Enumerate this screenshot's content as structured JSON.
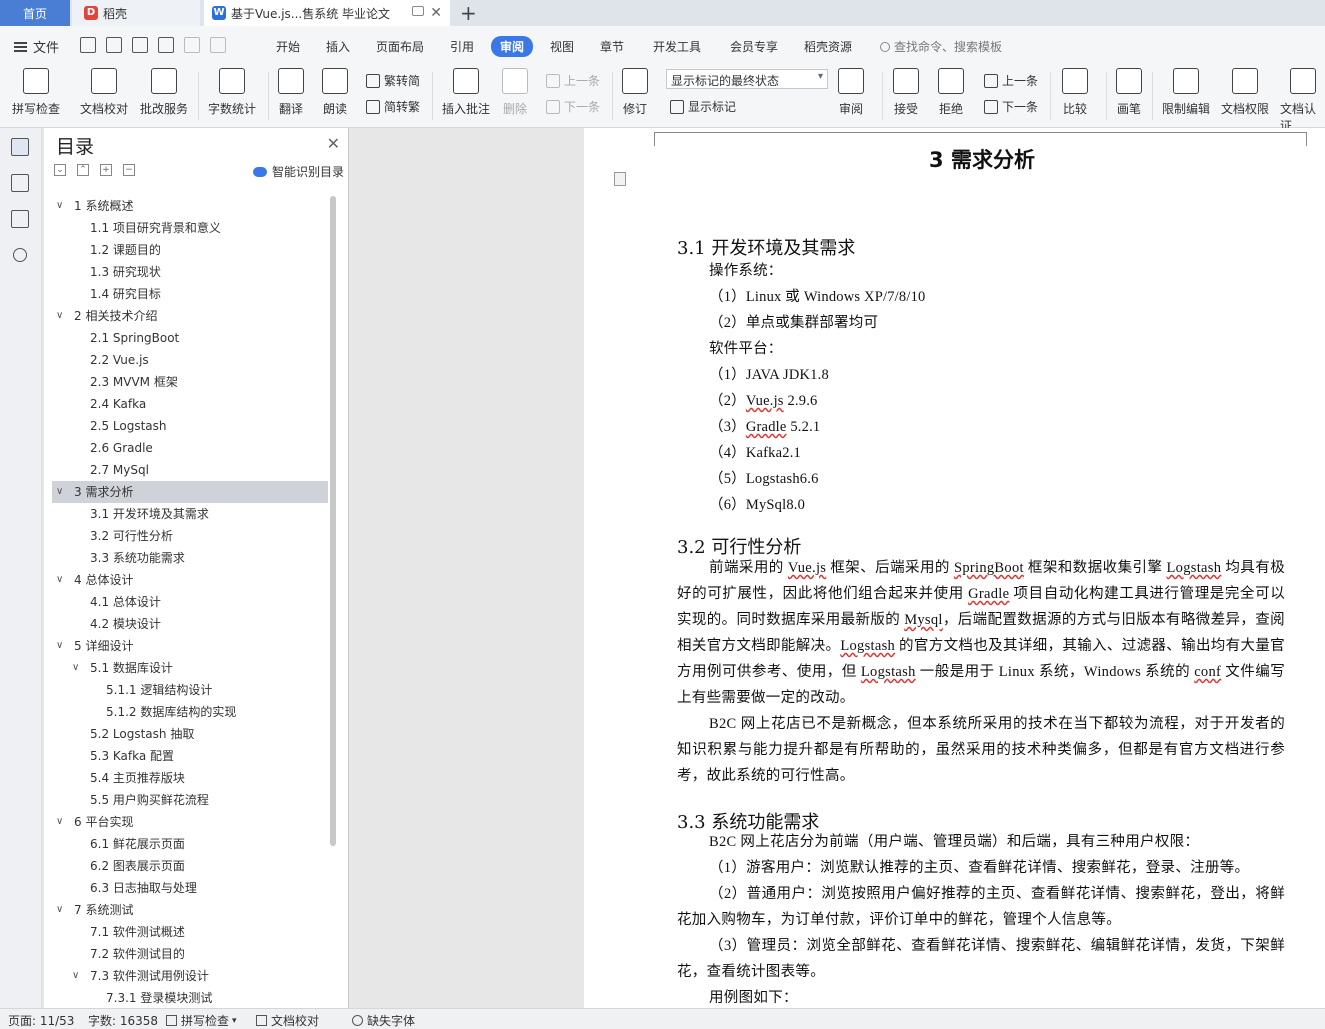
{
  "tabs": {
    "home": "首页",
    "daoke": "稻壳",
    "doc": "基于Vue.js...售系统 毕业论文"
  },
  "menu": {
    "file": "文件",
    "items": [
      "开始",
      "插入",
      "页面布局",
      "引用",
      "审阅",
      "视图",
      "章节",
      "开发工具",
      "会员专享",
      "稻壳资源"
    ],
    "active": "审阅",
    "search_placeholder": "查找命令、搜索模板"
  },
  "ribbon": {
    "spell": "拼写检查",
    "proof": "文档校对",
    "batch": "批改服务",
    "wordcount": "字数统计",
    "translate": "翻译",
    "read": "朗读",
    "trad": "繁转简",
    "simp": "简转繁",
    "insert_comment": "插入批注",
    "delete": "删除",
    "prev_comment": "上一条",
    "next_comment": "下一条",
    "revise": "修订",
    "display_state": "显示标记的最终状态",
    "show_marks": "显示标记",
    "review": "审阅",
    "accept": "接受",
    "reject": "拒绝",
    "prev": "上一条",
    "next": "下一条",
    "compare": "比较",
    "pen": "画笔",
    "restrict": "限制编辑",
    "perm": "文档权限",
    "cert": "文档认证"
  },
  "toc": {
    "title": "目录",
    "smart": "智能识别目录",
    "items": [
      {
        "text": "1  系统概述",
        "level": 1,
        "arrow": "down"
      },
      {
        "text": "1.1  项目研究背景和意义",
        "level": 2
      },
      {
        "text": "1.2  课题目的",
        "level": 2
      },
      {
        "text": "1.3  研究现状",
        "level": 2
      },
      {
        "text": "1.4  研究目标",
        "level": 2
      },
      {
        "text": "2  相关技术介绍",
        "level": 1,
        "arrow": "down"
      },
      {
        "text": "2.1 SpringBoot",
        "level": 2
      },
      {
        "text": "2.2 Vue.js",
        "level": 2
      },
      {
        "text": "2.3 MVVM 框架",
        "level": 2
      },
      {
        "text": "2.4 Kafka",
        "level": 2
      },
      {
        "text": "2.5 Logstash",
        "level": 2
      },
      {
        "text": "2.6 Gradle",
        "level": 2
      },
      {
        "text": "2.7 MySql",
        "level": 2
      },
      {
        "text": "3  需求分析",
        "level": 1,
        "arrow": "down",
        "selected": true
      },
      {
        "text": "3.1  开发环境及其需求",
        "level": 2
      },
      {
        "text": "3.2  可行性分析",
        "level": 2
      },
      {
        "text": "3.3  系统功能需求",
        "level": 2
      },
      {
        "text": "4  总体设计",
        "level": 1,
        "arrow": "down"
      },
      {
        "text": "4.1  总体设计",
        "level": 2
      },
      {
        "text": "4.2  模块设计",
        "level": 2
      },
      {
        "text": "5  详细设计",
        "level": 1,
        "arrow": "down"
      },
      {
        "text": "5.1  数据库设计",
        "level": 2,
        "arrow": "down"
      },
      {
        "text": "5.1.1  逻辑结构设计",
        "level": 3
      },
      {
        "text": "5.1.2  数据库结构的实现",
        "level": 3
      },
      {
        "text": "5.2 Logstash 抽取",
        "level": 2
      },
      {
        "text": "5.3 Kafka 配置",
        "level": 2
      },
      {
        "text": "5.4  主页推荐版块",
        "level": 2
      },
      {
        "text": "5.5  用户购买鲜花流程",
        "level": 2
      },
      {
        "text": "6  平台实现",
        "level": 1,
        "arrow": "down"
      },
      {
        "text": "6.1  鲜花展示页面",
        "level": 2
      },
      {
        "text": "6.2  图表展示页面",
        "level": 2
      },
      {
        "text": "6.3  日志抽取与处理",
        "level": 2
      },
      {
        "text": "7  系统测试",
        "level": 1,
        "arrow": "down"
      },
      {
        "text": "7.1  软件测试概述",
        "level": 2
      },
      {
        "text": "7.2  软件测试目的",
        "level": 2
      },
      {
        "text": "7.3  软件测试用例设计",
        "level": 2,
        "arrow": "down"
      },
      {
        "text": "7.3.1  登录模块测试",
        "level": 3
      }
    ]
  },
  "doc": {
    "chapter": "3  需求分析",
    "s31_title": "3.1  开发环境及其需求",
    "os_label": "操作系统：",
    "os_1": "（1）Linux 或 Windows XP/7/8/10",
    "os_2": "（2）单点或集群部署均可",
    "sw_label": "软件平台：",
    "sw_1": "（1）JAVA JDK1.8",
    "sw_2_pre": "（2）",
    "sw_2_word": "Vue.js",
    "sw_2_post": " 2.9.6",
    "sw_3_pre": "（3）",
    "sw_3_word": "Gradle",
    "sw_3_post": " 5.2.1",
    "sw_4": "（4）Kafka2.1",
    "sw_5": "（5）Logstash6.6",
    "sw_6": "（6）MySql8.0",
    "s32_title": "3.2  可行性分析",
    "p1_a": "前端采用的 ",
    "p1_w1": "Vue.js",
    "p1_b": " 框架、后端采用的 ",
    "p1_w2": "SpringBoot",
    "p1_c": " 框架和数据收集引擎 ",
    "p1_w3": "Logstash",
    "p1_d": " 均具有极好的可扩展性，因此将他们组合起来并使用 ",
    "p1_w4": "Gradle",
    "p1_e": " 项目自动化构建工具进行管理是完全可以实现的。同时数据库采用最新版的 ",
    "p1_w5": "Mysql",
    "p1_f": "，后端配置数据源的方式与旧版本有略微差异，查阅相关官方文档即能解决。",
    "p1_w6": "Logstash",
    "p1_g": " 的官方文档也及其详细，其输入、过滤器、输出均有大量官方用例可供参考、使用，但 ",
    "p1_w7": "Logstash",
    "p1_h": " 一般是用于 Linux 系统，Windows 系统的 ",
    "p1_w8": "conf",
    "p1_i": " 文件编写上有些需要做一定的改动。",
    "p2": "B2C 网上花店已不是新概念，但本系统所采用的技术在当下都较为流程，对于开发者的知识积累与能力提升都是有所帮助的，虽然采用的技术种类偏多，但都是有官方文档进行参考，故此系统的可行性高。",
    "s33_title": "3.3  系统功能需求",
    "p3": "B2C 网上花店分为前端（用户端、管理员端）和后端，具有三种用户权限：",
    "p4": "（1）游客用户：浏览默认推荐的主页、查看鲜花详情、搜索鲜花，登录、注册等。",
    "p5": "（2）普通用户：浏览按照用户偏好推荐的主页、查看鲜花详情、搜索鲜花，登出，将鲜花加入购物车，为订单付款，评价订单中的鲜花，管理个人信息等。",
    "p6": "（3）管理员：浏览全部鲜花、查看鲜花详情、搜索鲜花、编辑鲜花详情，发货，下架鲜花，查看统计图表等。",
    "p7": "用例图如下："
  },
  "status": {
    "page": "页面: 11/53",
    "words": "字数: 16358",
    "spell": "拼写检查",
    "proof": "文档校对",
    "font": "缺失字体"
  },
  "colors": {
    "accent": "#3b78e7",
    "home_tab": "#4a7ed4",
    "spell_underline": "#d33333"
  }
}
